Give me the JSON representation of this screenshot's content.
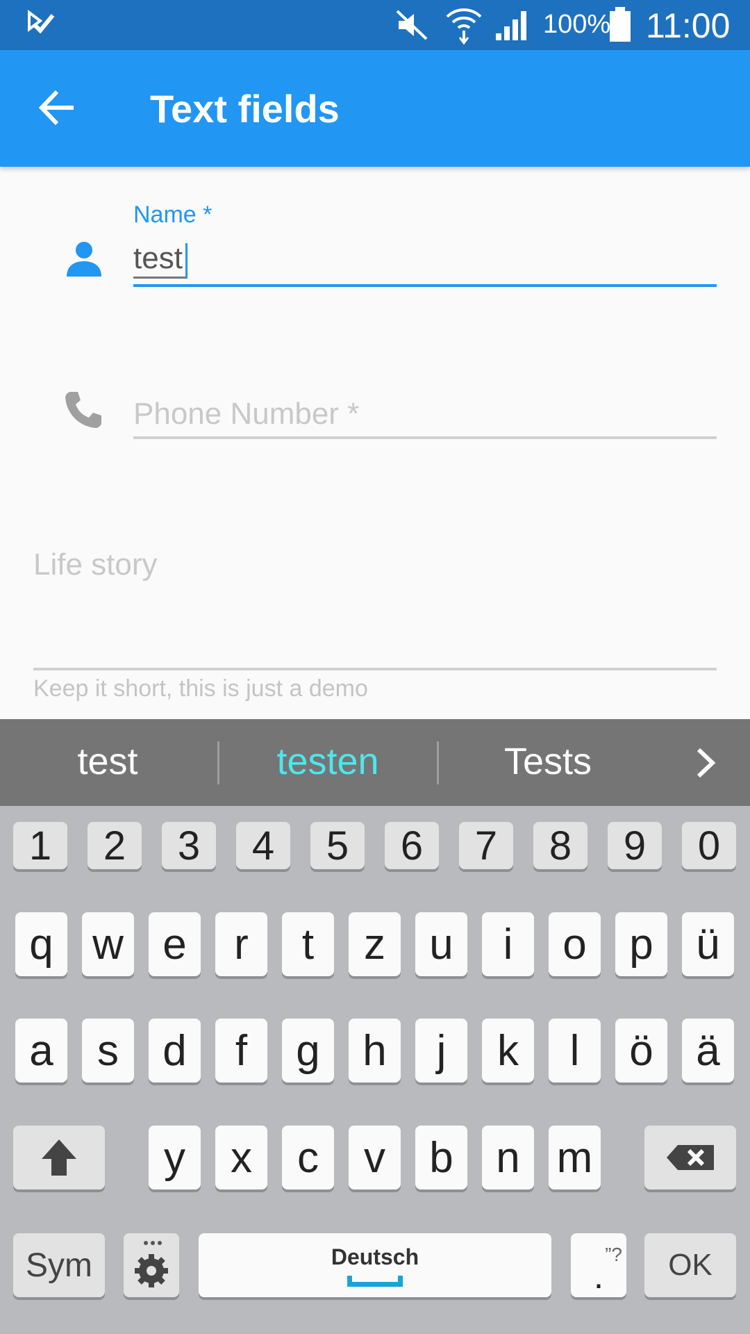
{
  "status_bar": {
    "battery_percent": "100%",
    "time": "11:00"
  },
  "app_bar": {
    "title": "Text fields"
  },
  "form": {
    "name": {
      "label": "Name *",
      "value": "test"
    },
    "phone": {
      "placeholder": "Phone Number *"
    },
    "life_story": {
      "placeholder": "Life story",
      "helper": "Keep it short, this is just a demo"
    }
  },
  "suggestions": [
    "test",
    "testen",
    "Tests"
  ],
  "keyboard": {
    "numbers": [
      "1",
      "2",
      "3",
      "4",
      "5",
      "6",
      "7",
      "8",
      "9",
      "0"
    ],
    "row1": [
      "q",
      "w",
      "e",
      "r",
      "t",
      "z",
      "u",
      "i",
      "o",
      "p",
      "ü"
    ],
    "row2": [
      "a",
      "s",
      "d",
      "f",
      "g",
      "h",
      "j",
      "k",
      "l",
      "ö",
      "ä"
    ],
    "row3": [
      "y",
      "x",
      "c",
      "v",
      "b",
      "n",
      "m"
    ],
    "sym_label": "Sym",
    "space_label": "Deutsch",
    "period_label": ".",
    "period_hint": "”?",
    "ok_label": "OK"
  },
  "colors": {
    "accent": "#2196f3",
    "status_bar": "#1e71bf",
    "suggestion_highlight": "#4ee6ee"
  }
}
